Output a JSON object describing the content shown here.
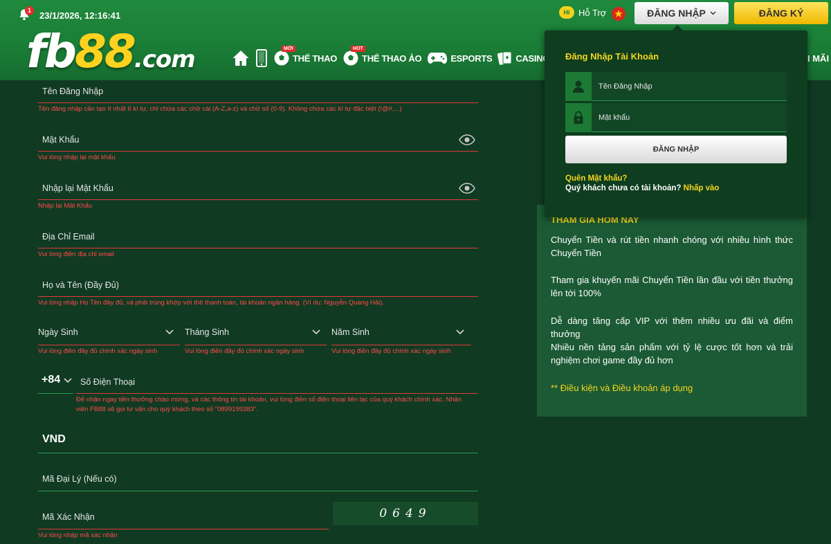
{
  "header": {
    "notification_count": "1",
    "datetime": "23/1/2026, 12:16:41",
    "logo": {
      "brand": "fb",
      "number": "88",
      "tld": ".com"
    },
    "support_badge": "Hi",
    "support_label": "Hỗ Trợ",
    "login_button": "ĐĂNG NHẬP",
    "register_button": "ĐĂNG KÝ",
    "nav": [
      {
        "label": "",
        "icon": "home-icon"
      },
      {
        "label": "",
        "icon": "mobile-icon"
      },
      {
        "label": "THỂ THAO",
        "icon": "soccer-ball-icon",
        "tag": "MỚI"
      },
      {
        "label": "THỂ THAO ẢO",
        "icon": "soccer-ball-icon",
        "tag": "HOT"
      },
      {
        "label": "ESPORTS",
        "icon": "gamepad-icon"
      },
      {
        "label": "CASINO TR",
        "icon": "cards-icon"
      }
    ],
    "nav_tail": "I MÃI"
  },
  "form": {
    "username": {
      "label": "Tên Đăng Nhập",
      "error": "Tên đăng nhập cần tạo ít nhất 6 kí tự, chỉ chứa các chữ cái (A-Z,a-z) và chữ số (0-9). Không chứa các kí tự đặc biệt (!@#,...)"
    },
    "password": {
      "label": "Mật Khẩu",
      "error": "Vui lòng nhập lại mật khẩu"
    },
    "confirm_password": {
      "label": "Nhập lại Mật Khẩu",
      "error": "Nhập lại Mật Khẩu"
    },
    "email": {
      "label": "Địa Chỉ Email",
      "error": "Vui lòng điền địa chỉ email"
    },
    "fullname": {
      "label": "Họ và Tên (Đầy Đủ)",
      "error": "Vui lòng nhập Họ Tên đầy đủ, và phải trùng khớp với thẻ thanh toán, tài khoản ngân hàng. (Ví dụ: Nguyễn Quang Hải)."
    },
    "birth_day": {
      "label": "Ngày Sinh",
      "error": "Vui lòng điền đầy đủ chính xác ngày sinh"
    },
    "birth_month": {
      "label": "Tháng Sinh",
      "error": "Vui lòng điền đầy đủ chính xác ngày sinh"
    },
    "birth_year": {
      "label": "Năm Sinh",
      "error": "Vui lòng điền đầy đủ chính xác ngày sinh"
    },
    "phone_code": "+84",
    "phone": {
      "label": "Số Điện Thoại",
      "error_line1": "Để nhận ngay tiền thưởng chào mừng, và các thông tin tài khoản, vui lòng điền số điện thoại liên lạc của quý khách chính xác. Nhân",
      "error_line2": "viên FB88 sẽ gọi tư vấn cho quý khách theo số \"0899199383\"."
    },
    "currency": "VND",
    "agent_code": {
      "label": "Mã Đại Lý (Nếu có)"
    },
    "captcha": {
      "label": "Mã Xác Nhận",
      "code": "0649",
      "error": "Vui lòng nhập mã xác nhận"
    }
  },
  "promo": {
    "title": "THAM GIA HÔM NAY",
    "points": [
      "Chuyển Tiền và rút tiền nhanh chóng với nhiều hình thức Chuyển Tiền",
      "Tham gia khuyến mãi Chuyển Tiền lần đầu với tiền thưởng lên tới 100%",
      "Dễ dàng tăng cấp VIP với thêm nhiều ưu đãi và điểm thưởng",
      "Nhiều nền tảng sản phẩm với tỷ lệ cược tốt hơn và trải nghiệm chơi game đầy đủ hơn"
    ],
    "terms_link": "** Điều kiện và Điều khoản áp dụng"
  },
  "login_popup": {
    "title": "Đăng Nhập Tài Khoản",
    "username_placeholder": "Tên Đăng Nhập",
    "password_placeholder": "Mật khẩu",
    "submit": "ĐĂNG NHẬP",
    "forgot": "Quên Mật khẩu?",
    "no_account": "Quý khách chưa có tài khoản?",
    "signup_link": "Nhấp vào"
  },
  "colors": {
    "header_green": "#1a7d36",
    "page_bg": "#103a22",
    "accent_yellow": "#f5d61e",
    "error_red": "#ff4b4b"
  }
}
